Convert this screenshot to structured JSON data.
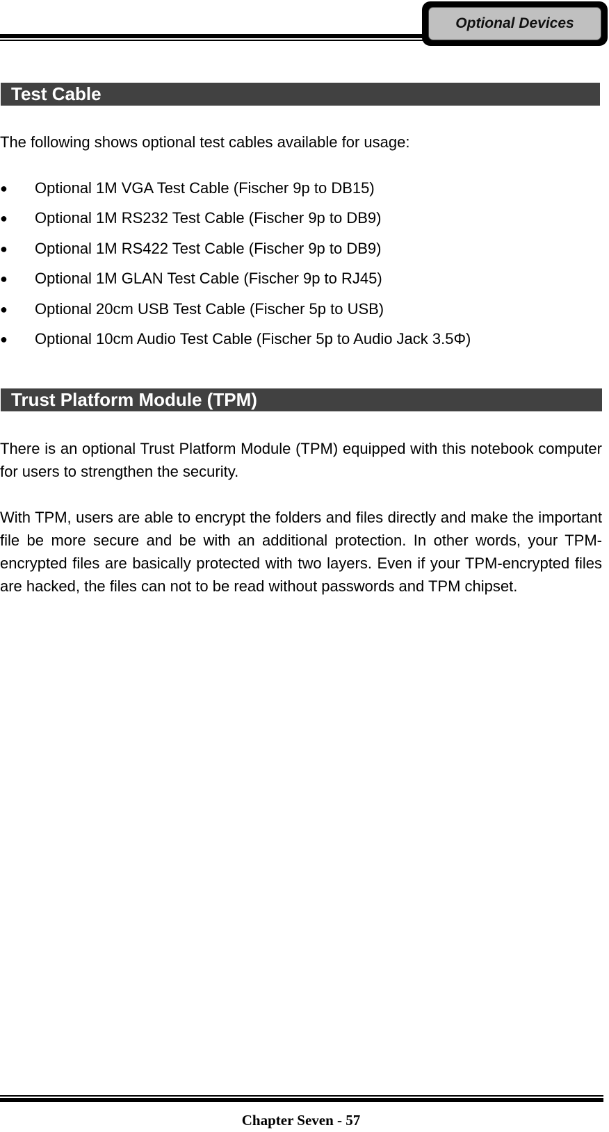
{
  "header": {
    "tab_label": "Optional Devices"
  },
  "sections": [
    {
      "title": "Test Cable",
      "intro": "The following shows optional test cables available for usage:",
      "bullet_glyph": "●",
      "items": [
        "Optional 1M VGA Test Cable (Fischer 9p to DB15)",
        "Optional 1M RS232 Test Cable (Fischer 9p to DB9)",
        "Optional 1M RS422 Test Cable (Fischer 9p to DB9)",
        "Optional 1M GLAN Test Cable (Fischer 9p to RJ45)",
        "Optional 20cm USB Test Cable (Fischer 5p to USB)",
        "Optional 10cm Audio Test Cable (Fischer 5p to Audio Jack 3.5Φ)"
      ]
    },
    {
      "title": "Trust Platform Module (TPM)",
      "paragraphs": [
        "There is an optional Trust Platform Module (TPM) equipped with this notebook computer for users to strengthen the security.",
        "With TPM, users are able to encrypt the folders and files directly and make the important file be more secure and be with an additional protection. In other words, your TPM-encrypted files are basically protected with two layers. Even if your TPM-encrypted files are hacked, the files can not to be read without passwords and TPM chipset."
      ]
    }
  ],
  "footer": {
    "page_label": "Chapter Seven - 57"
  }
}
